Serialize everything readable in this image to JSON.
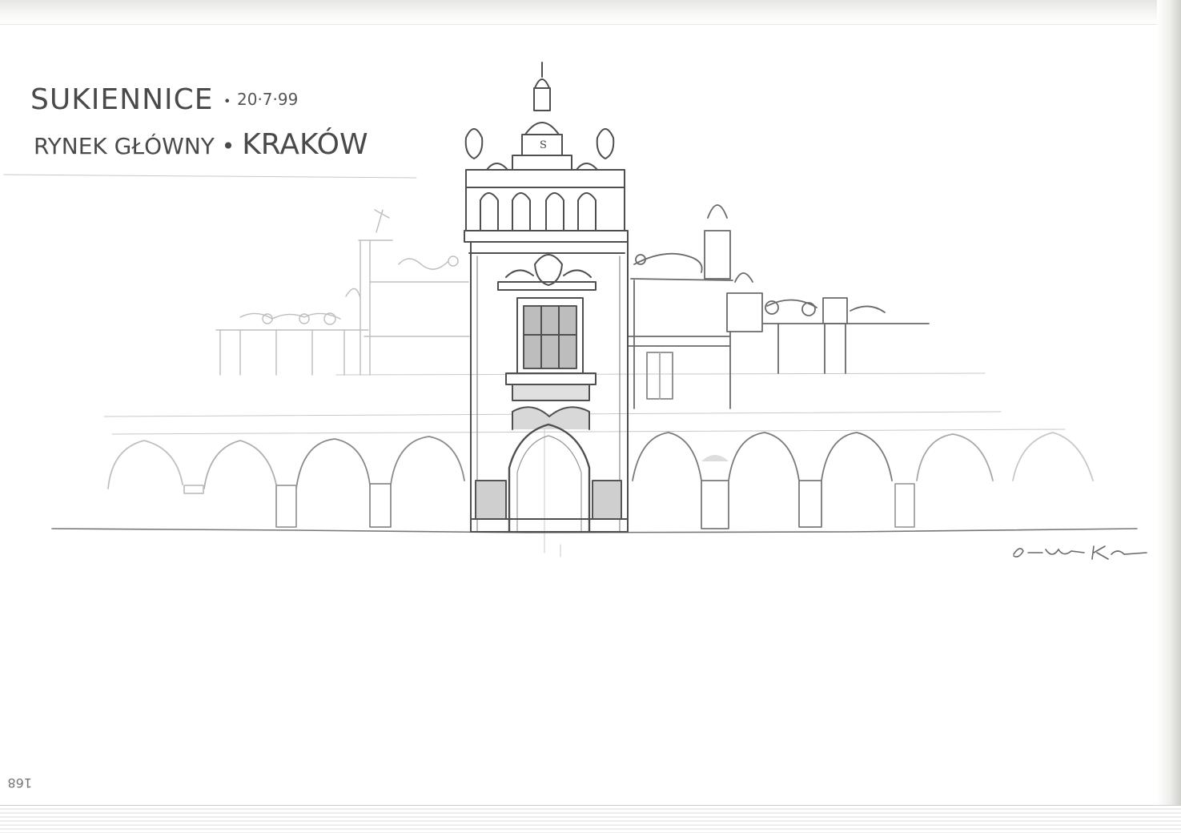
{
  "sketchbook": {
    "title": "SUKIENNICE",
    "title_separator": "•",
    "date": "20·7·99",
    "subtitle_left": "RYNEK GŁÓWNY",
    "subtitle_separator": "•",
    "subtitle_city": "KRAKÓW",
    "tower_monogram": "S",
    "page_number": "168"
  },
  "colors": {
    "paper": "#ffffff",
    "pencil": "#5a5a5a",
    "pencil_light": "#b9b9b9",
    "shade": "#cfcfcf"
  }
}
